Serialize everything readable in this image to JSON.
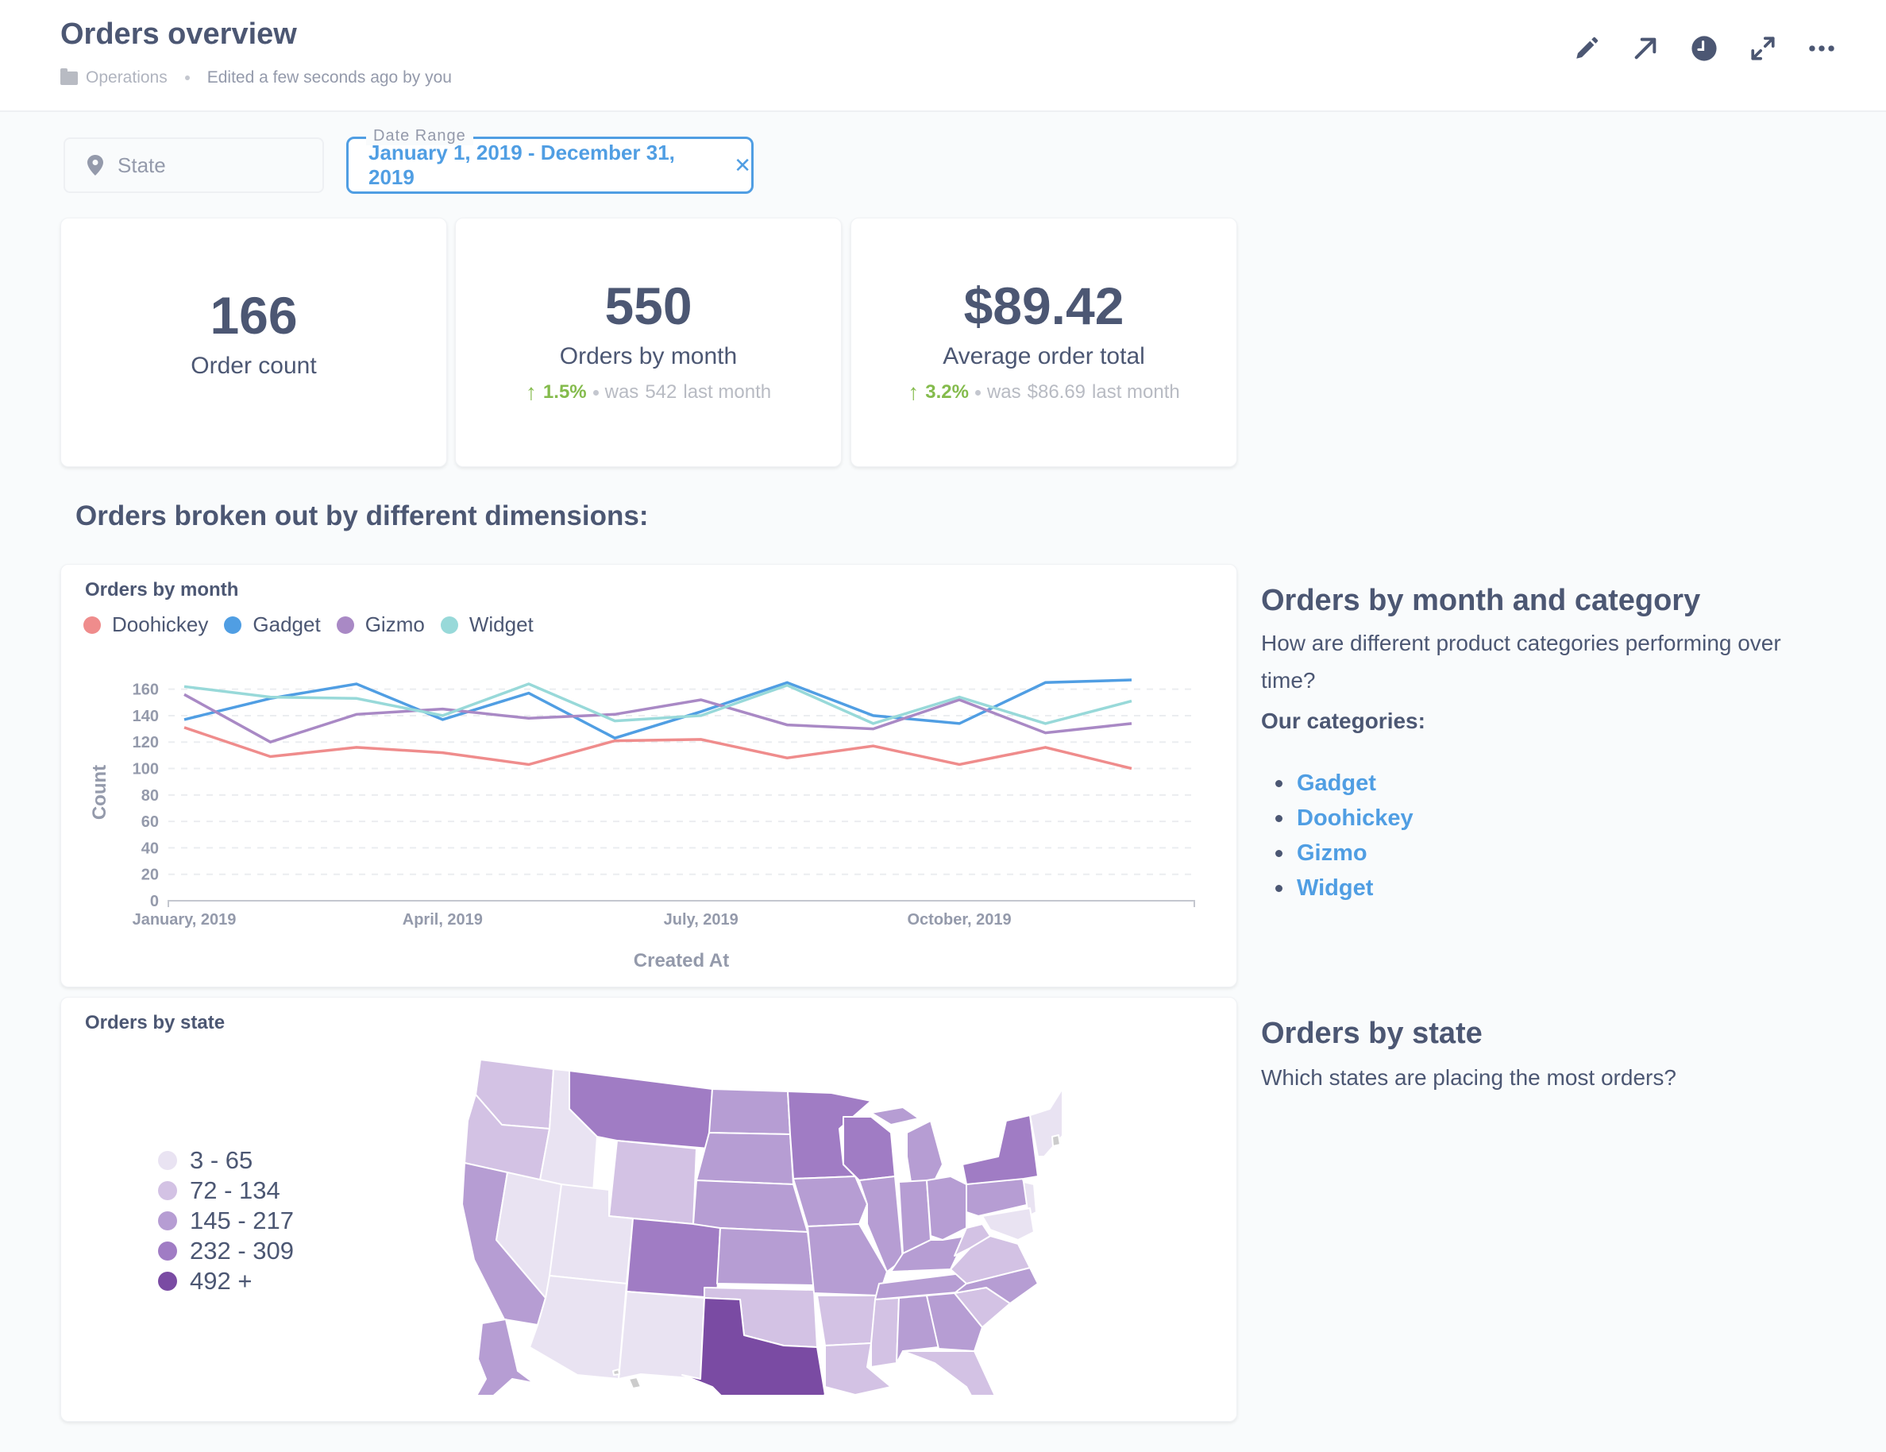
{
  "header": {
    "title": "Orders overview",
    "collection": "Operations",
    "edited": "Edited a few seconds ago by you",
    "icons": [
      "pencil-icon",
      "share-arrow-icon",
      "clock-icon",
      "fullscreen-icon",
      "more-icon"
    ]
  },
  "filters": {
    "state": {
      "placeholder": "State",
      "icon": "location-pin-icon"
    },
    "date_range": {
      "label": "Date Range",
      "value": "January 1, 2019 - December 31, 2019",
      "clear": "✕"
    }
  },
  "kpis": [
    {
      "value": "166",
      "label": "Order count"
    },
    {
      "value": "550",
      "label": "Orders by month",
      "change": "1.5%",
      "was_prefix": "was",
      "was_value": "542",
      "period": "last month"
    },
    {
      "value": "$89.42",
      "label": "Average order total",
      "change": "3.2%",
      "was_prefix": "was",
      "was_value": "$86.69",
      "period": "last month"
    }
  ],
  "section_heading": "Orders broken out by different dimensions:",
  "line_card": {
    "title": "Orders by month"
  },
  "map_card": {
    "title": "Orders by state",
    "legend": [
      {
        "label": "3 - 65",
        "color": "#e9e3f2"
      },
      {
        "label": "72 - 134",
        "color": "#d3c2e4"
      },
      {
        "label": "145 - 217",
        "color": "#b69dd3"
      },
      {
        "label": "232 - 309",
        "color": "#a07cc4"
      },
      {
        "label": "492 +",
        "color": "#7a4ba3"
      }
    ]
  },
  "side_panels": {
    "month_category": {
      "heading": "Orders by month and category",
      "text": "How are different product categories performing over time?",
      "categories_heading": "Our categories:",
      "categories": [
        "Gadget",
        "Doohickey",
        "Gizmo",
        "Widget"
      ]
    },
    "state": {
      "heading": "Orders by state",
      "text": "Which states are placing the most orders?"
    }
  },
  "colors": {
    "brand": "#509ee3",
    "text": "#4c5773",
    "positive": "#84bb4c"
  },
  "chart_data": {
    "type": "line",
    "title": "Orders by month",
    "xlabel": "Created At",
    "ylabel": "Count",
    "ylim": [
      0,
      170
    ],
    "yticks": [
      0,
      20,
      40,
      60,
      80,
      100,
      120,
      140,
      160
    ],
    "x": [
      "January, 2019",
      "February, 2019",
      "March, 2019",
      "April, 2019",
      "May, 2019",
      "June, 2019",
      "July, 2019",
      "August, 2019",
      "September, 2019",
      "October, 2019",
      "November, 2019",
      "December, 2019"
    ],
    "xtick_labels": [
      "January, 2019",
      "April, 2019",
      "July, 2019",
      "October, 2019"
    ],
    "xtick_indices": [
      0,
      3,
      6,
      9
    ],
    "grid": true,
    "legend_position": "top-left",
    "series": [
      {
        "name": "Doohickey",
        "color": "#ef8c8c",
        "values": [
          131,
          109,
          116,
          112,
          103,
          121,
          122,
          108,
          117,
          103,
          116,
          100
        ]
      },
      {
        "name": "Gadget",
        "color": "#509ee3",
        "values": [
          137,
          153,
          164,
          137,
          157,
          123,
          143,
          165,
          140,
          134,
          165,
          167
        ]
      },
      {
        "name": "Gizmo",
        "color": "#a989c5",
        "values": [
          156,
          120,
          141,
          145,
          138,
          141,
          152,
          133,
          130,
          152,
          127,
          134
        ]
      },
      {
        "name": "Widget",
        "color": "#98d9d9",
        "values": [
          162,
          154,
          153,
          140,
          164,
          136,
          140,
          163,
          134,
          154,
          134,
          151
        ]
      }
    ]
  }
}
